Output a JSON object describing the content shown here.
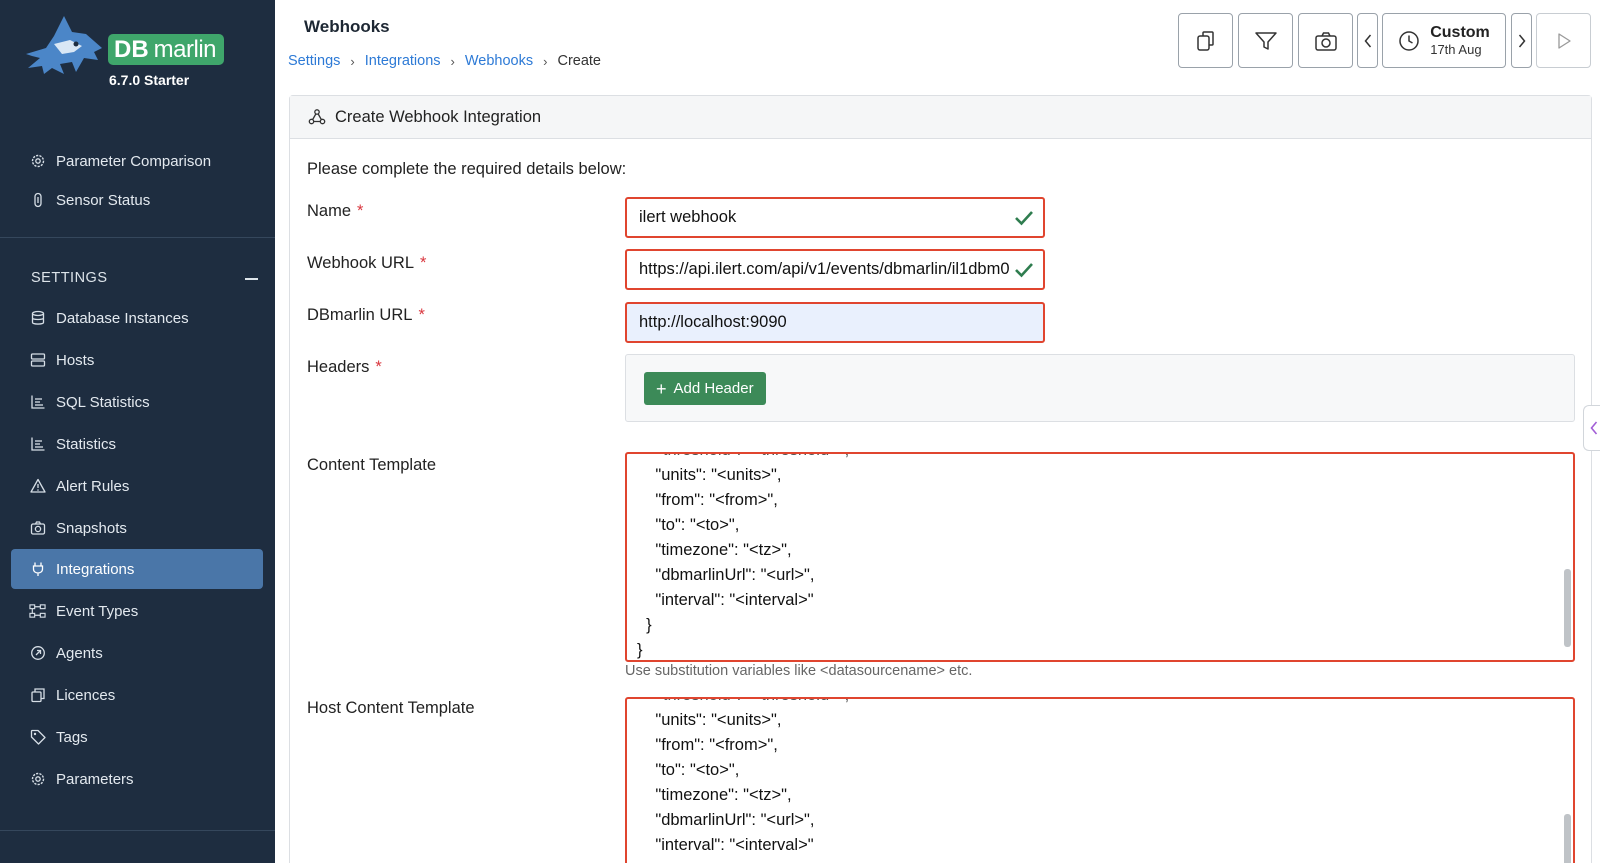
{
  "app": {
    "logo_db": "DB",
    "logo_marlin": "marlin",
    "version": "6.7.0 Starter",
    "brand_color": "#3fa66b"
  },
  "sidebar": {
    "top_items": [
      {
        "label": "Parameter Comparison",
        "icon": "gear-icon"
      },
      {
        "label": "Sensor Status",
        "icon": "sensor-icon"
      }
    ],
    "settings_heading": "SETTINGS",
    "items": [
      {
        "label": "Database Instances",
        "icon": "database-icon"
      },
      {
        "label": "Hosts",
        "icon": "server-icon"
      },
      {
        "label": "SQL Statistics",
        "icon": "chart-icon"
      },
      {
        "label": "Statistics",
        "icon": "chart-icon"
      },
      {
        "label": "Alert Rules",
        "icon": "warning-icon"
      },
      {
        "label": "Snapshots",
        "icon": "camera-icon"
      },
      {
        "label": "Integrations",
        "icon": "plug-icon",
        "active": true
      },
      {
        "label": "Event Types",
        "icon": "event-types-icon"
      },
      {
        "label": "Agents",
        "icon": "agent-icon"
      },
      {
        "label": "Licences",
        "icon": "licence-icon"
      },
      {
        "label": "Tags",
        "icon": "tag-icon"
      },
      {
        "label": "Parameters",
        "icon": "gear-icon"
      }
    ]
  },
  "header": {
    "title": "Webhooks",
    "breadcrumb": [
      "Settings",
      "Integrations",
      "Webhooks",
      "Create"
    ],
    "time_range": {
      "label": "Custom",
      "date": "17th Aug"
    }
  },
  "form": {
    "card_title": "Create Webhook Integration",
    "intro": "Please complete the required details below:",
    "name_label": "Name",
    "name_value": "ilert webhook",
    "webhook_url_label": "Webhook URL",
    "webhook_url_value": "https://api.ilert.com/api/v1/events/dbmarlin/il1dbm0",
    "dbmarlin_url_label": "DBmarlin URL",
    "dbmarlin_url_value": "http://localhost:9090",
    "headers_label": "Headers",
    "add_header_label": "Add Header",
    "content_template_label": "Content Template",
    "content_template_lines": [
      "    \"units\": \"<units>\",",
      "    \"from\": \"<from>\",",
      "    \"to\": \"<to>\",",
      "    \"timezone\": \"<tz>\",",
      "    \"dbmarlinUrl\": \"<url>\",",
      "    \"interval\": \"<interval>\"",
      "  }",
      "}"
    ],
    "hint": "Use substitution variables like <datasourcename> etc.",
    "host_content_template_label": "Host Content Template",
    "host_content_template_lines": [
      "    \"units\": \"<units>\",",
      "    \"from\": \"<from>\",",
      "    \"to\": \"<to>\",",
      "    \"timezone\": \"<tz>\",",
      "    \"dbmarlinUrl\": \"<url>\",",
      "    \"interval\": \"<interval>\""
    ]
  },
  "colors": {
    "sidebar_bg": "#1e2d40",
    "active_item": "#4a76a8",
    "error_border": "#e0452f",
    "link": "#2d7ad6",
    "success": "#3c8a58"
  }
}
